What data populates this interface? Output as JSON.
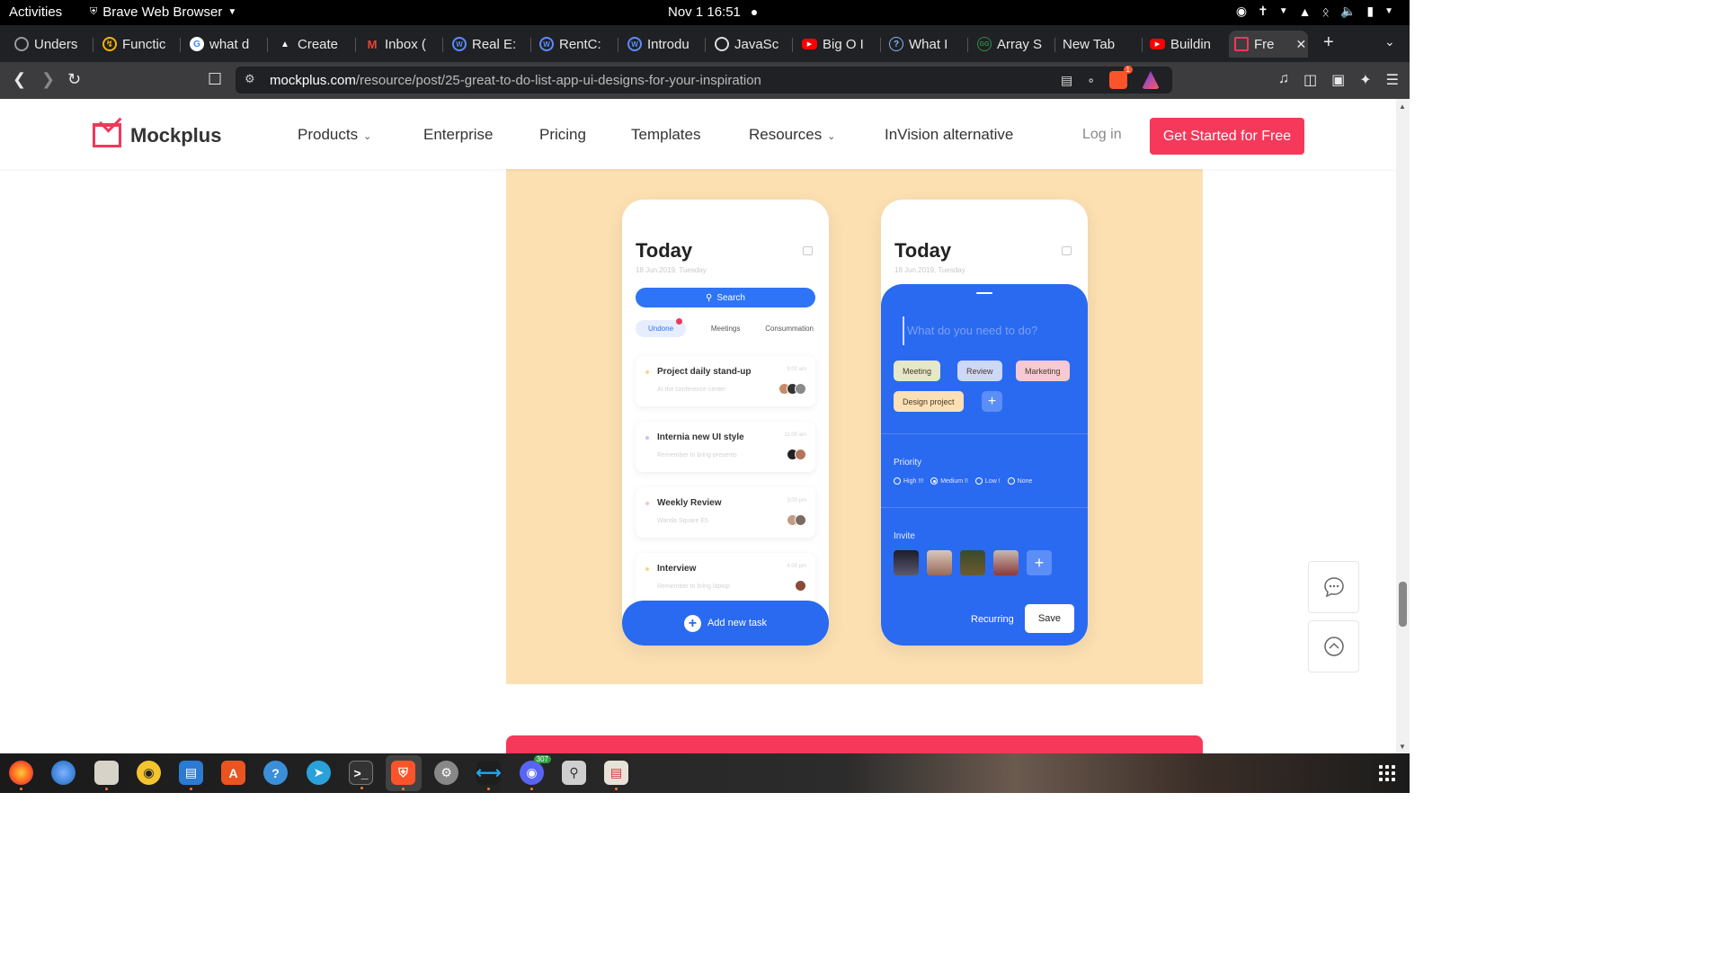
{
  "topbar": {
    "activities": "Activities",
    "app_name": "Brave Web Browser",
    "clock": "Nov 1  16:51"
  },
  "tabs": [
    {
      "label": "Unders",
      "favicon": "openai-icon",
      "color": "#9a9a9a"
    },
    {
      "label": "Functic",
      "favicon": "bolt-icon",
      "color": "#f4b400"
    },
    {
      "label": "what d",
      "favicon": "google-icon",
      "color": "#4285f4"
    },
    {
      "label": "Create",
      "favicon": "triangle-icon",
      "color": "#ffffff"
    },
    {
      "label": "Inbox (",
      "favicon": "gmail-icon",
      "color": "#ea4335"
    },
    {
      "label": "Real E:",
      "favicon": "w3-icon",
      "color": "#5b8cff"
    },
    {
      "label": "RentC:",
      "favicon": "w3-icon",
      "color": "#5b8cff"
    },
    {
      "label": "Introdu",
      "favicon": "w3-icon",
      "color": "#5b8cff"
    },
    {
      "label": "JavaSc",
      "favicon": "circle-icon",
      "color": "#dddddd"
    },
    {
      "label": "Big O I",
      "favicon": "youtube-icon",
      "color": "#ff0000"
    },
    {
      "label": "What I",
      "favicon": "question-icon",
      "color": "#8ab4f8"
    },
    {
      "label": "Array S",
      "favicon": "gfg-icon",
      "color": "#2f8d46"
    },
    {
      "label": "New Tab",
      "favicon": "",
      "color": ""
    },
    {
      "label": "Buildin",
      "favicon": "youtube-icon",
      "color": "#ff0000"
    },
    {
      "label": "Fre",
      "favicon": "mockplus-icon",
      "color": "#f0385a"
    }
  ],
  "address": {
    "domain": "mockplus.com",
    "path": "/resource/post/25-great-to-do-list-app-ui-designs-for-your-inspiration",
    "shields_count": "1",
    "rewards_count": "1"
  },
  "site": {
    "brand": "Mockplus",
    "nav": {
      "products": "Products",
      "enterprise": "Enterprise",
      "pricing": "Pricing",
      "templates": "Templates",
      "resources": "Resources",
      "invision": "InVision alternative"
    },
    "login": "Log in",
    "cta": "Get Started for Free",
    "accent": "#f6385a"
  },
  "mockup": {
    "title": "Today",
    "date": "18 Jun.2019, Tuesday",
    "search": "Search",
    "tabs": [
      "Undone",
      "Meetings",
      "Consummation"
    ],
    "tasks": [
      {
        "name": "Project daily stand-up",
        "sub": "At the conference center",
        "time": "9:00 am"
      },
      {
        "name": "Internia new UI style",
        "sub": "Remember to bring presents",
        "time": "11:00 am"
      },
      {
        "name": "Weekly Review",
        "sub": "Wanda Square E5",
        "time": "3:00 pm"
      },
      {
        "name": "Interview",
        "sub": "Remember to bring laptop",
        "time": "4:00 pm"
      }
    ],
    "add_task": "Add new task",
    "placeholder": "What do you need to do?",
    "chips": [
      "Meeting",
      "Review",
      "Marketing",
      "Design project"
    ],
    "priority_label": "Priority",
    "priorities": [
      "High !!!",
      "Medium !!",
      "Low !",
      "None"
    ],
    "priority_selected": "Medium !!",
    "invite_label": "Invite",
    "recurring": "Recurring",
    "save": "Save"
  },
  "dock": {
    "discord_badge": "307"
  }
}
